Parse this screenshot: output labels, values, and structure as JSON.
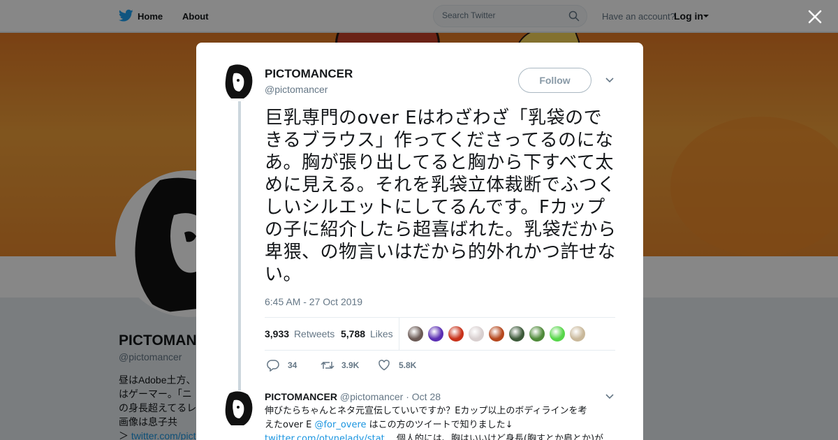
{
  "nav": {
    "home_label": "Home",
    "about_label": "About",
    "search_placeholder": "Search Twitter",
    "have_account": "Have an account?",
    "login_label": "Log in"
  },
  "profile": {
    "name": "PICTOMANCER",
    "handle": "@pictomancer",
    "bio_lines": [
      "昼はAdobe土方、",
      "はゲーマー。「ニ",
      "の身長超えてるレ",
      "画像は息子共"
    ],
    "bio_link": "twitter.com/picto"
  },
  "tweet": {
    "author_name": "PICTOMANCER",
    "author_handle": "@pictomancer",
    "follow_label": "Follow",
    "text": "巨乳専門のover Eはわざわざ「乳袋のできるブラウス」作ってくださってるのになあ。胸が張り出してると胸から下すべて太めに見える。それを乳袋立体裁断でふつくしいシルエットにしてるんです。Fカップの子に紹介したら超喜ばれた。乳袋だから卑猥、の物言いはだから的外れかつ許せない。",
    "timestamp": "6:45 AM - 27 Oct 2019",
    "retweets_count": "3,933",
    "retweets_label": "Retweets",
    "likes_count": "5,788",
    "likes_label": "Likes",
    "reply_count": "34",
    "retweet_action_count": "3.9K",
    "like_action_count": "5.8K",
    "liker_colors": [
      "#6b5a55",
      "#5b2fb3",
      "#c8321a",
      "#d8cfcf",
      "#b5481e",
      "#3d5a3a",
      "#4f8a3a",
      "#57d64a",
      "#c9b89a"
    ]
  },
  "reply": {
    "name": "PICTOMANCER",
    "handle": "@pictomancer",
    "date": "· Oct 28",
    "text_line1": "伸びたらちゃんとネタ元宣伝していいですか？Eカップ以上のボディラインを考",
    "text_line2_pre": "えたover E ",
    "mention": "@for_overe",
    "text_line2_post": " はこの方のツイートで知りました↓",
    "text_line3_link": "twitter.com/otvnelady/stat…",
    "text_line3_post": " 個人的には、胸はいいけど身長(胸すとか肩とか)が"
  },
  "colors": {
    "accent": "#1da1f2",
    "link": "#1b95e0",
    "banner": "#e57b26"
  }
}
